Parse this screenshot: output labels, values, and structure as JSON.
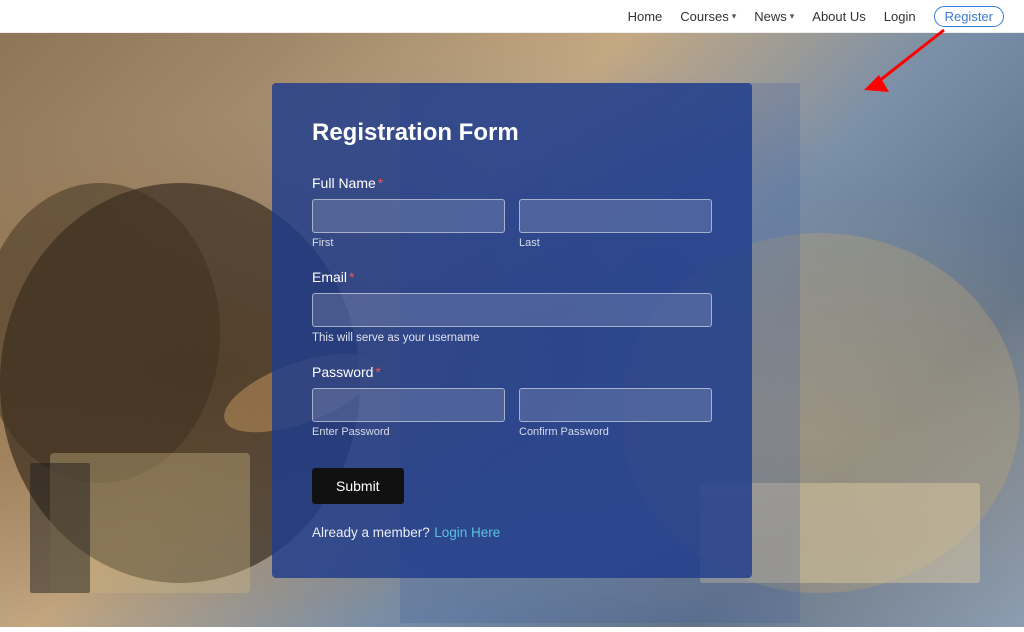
{
  "navbar": {
    "home_label": "Home",
    "courses_label": "Courses",
    "courses_chevron": "▾",
    "news_label": "News",
    "news_chevron": "▾",
    "about_label": "About Us",
    "login_label": "Login",
    "register_label": "Register"
  },
  "form": {
    "title": "Registration Form",
    "full_name_label": "Full Name",
    "first_sublabel": "First",
    "last_sublabel": "Last",
    "email_label": "Email",
    "email_hint": "This will serve as your username",
    "password_label": "Password",
    "enter_password_sublabel": "Enter Password",
    "confirm_password_sublabel": "Confirm Password",
    "submit_label": "Submit",
    "already_member_text": "Already a member?",
    "login_here_label": "Login Here"
  }
}
